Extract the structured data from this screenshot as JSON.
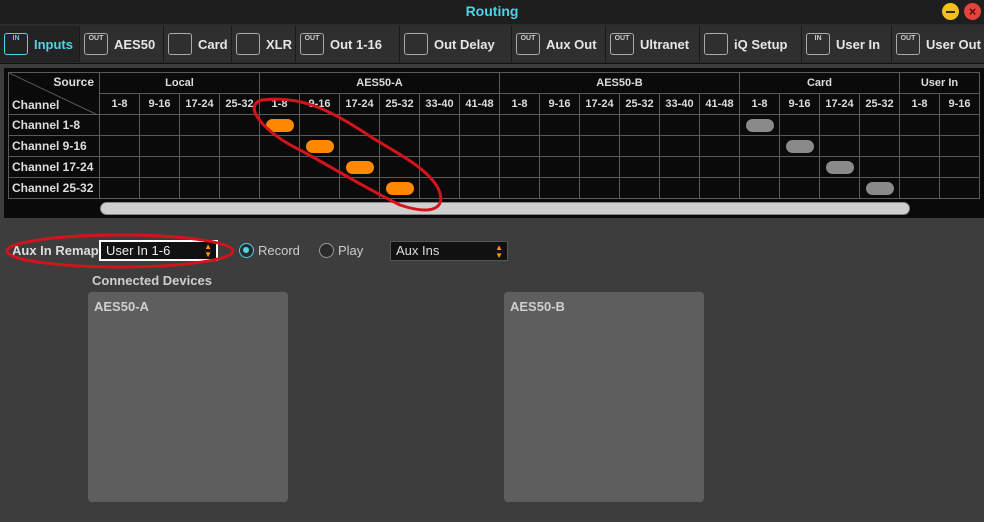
{
  "window": {
    "title": "Routing"
  },
  "tabs": [
    {
      "label": "Inputs",
      "icon": "in",
      "active": true
    },
    {
      "label": "AES50",
      "icon": "out"
    },
    {
      "label": "Card",
      "icon": "card"
    },
    {
      "label": "XLR",
      "icon": "xlr"
    },
    {
      "label": "Out 1-16",
      "icon": "out"
    },
    {
      "label": "Out Delay",
      "icon": "delay"
    },
    {
      "label": "Aux Out",
      "icon": "out"
    },
    {
      "label": "Ultranet",
      "icon": "out"
    },
    {
      "label": "iQ Setup",
      "icon": "speaker"
    },
    {
      "label": "User In",
      "icon": "in"
    },
    {
      "label": "User Out",
      "icon": "out"
    }
  ],
  "tab_icon_text": {
    "in": "IN",
    "out": "OUT"
  },
  "matrix": {
    "source_label": "Source",
    "channel_label": "Channel",
    "groups": [
      {
        "name": "Local",
        "cols": [
          "1-8",
          "9-16",
          "17-24",
          "25-32"
        ]
      },
      {
        "name": "AES50-A",
        "cols": [
          "1-8",
          "9-16",
          "17-24",
          "25-32",
          "33-40",
          "41-48"
        ]
      },
      {
        "name": "AES50-B",
        "cols": [
          "1-8",
          "9-16",
          "17-24",
          "25-32",
          "33-40",
          "41-48"
        ]
      },
      {
        "name": "Card",
        "cols": [
          "1-8",
          "9-16",
          "17-24",
          "25-32"
        ]
      },
      {
        "name": "User In",
        "cols": [
          "1-8",
          "9-16"
        ]
      }
    ],
    "rows": [
      "Channel 1-8",
      "Channel 9-16",
      "Channel 17-24",
      "Channel 25-32"
    ],
    "routes": [
      {
        "row": 0,
        "col": 4,
        "state": "active"
      },
      {
        "row": 1,
        "col": 5,
        "state": "active"
      },
      {
        "row": 2,
        "col": 6,
        "state": "active"
      },
      {
        "row": 3,
        "col": 7,
        "state": "active"
      },
      {
        "row": 0,
        "col": 16,
        "state": "inactive"
      },
      {
        "row": 1,
        "col": 17,
        "state": "inactive"
      },
      {
        "row": 2,
        "col": 18,
        "state": "inactive"
      },
      {
        "row": 3,
        "col": 19,
        "state": "inactive"
      }
    ]
  },
  "aux_remap": {
    "label": "Aux In Remap",
    "value": "User In 1-6",
    "mode_options": [
      {
        "label": "Record",
        "checked": true
      },
      {
        "label": "Play",
        "checked": false
      }
    ],
    "aux_select": "Aux Ins"
  },
  "connected_devices": {
    "title": "Connected Devices",
    "devices": [
      "AES50-A",
      "AES50-B"
    ]
  },
  "colors": {
    "accent": "#4fd3e8",
    "route_active": "#ff8800",
    "route_inactive": "#8a8a8a",
    "annotation": "#d4141c"
  }
}
